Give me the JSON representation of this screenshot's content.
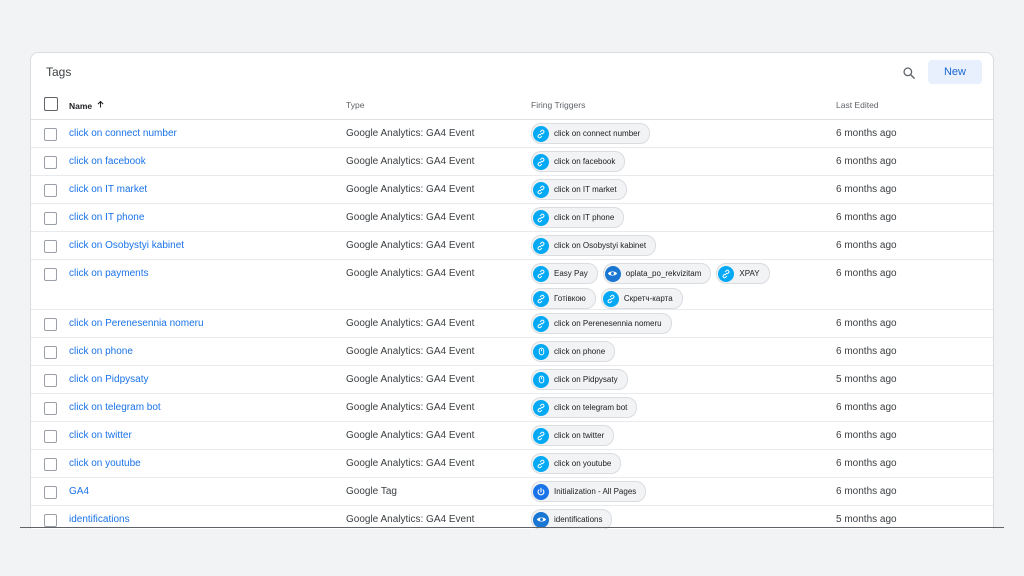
{
  "header": {
    "title": "Tags",
    "new_label": "New"
  },
  "columns": {
    "name": "Name",
    "type": "Type",
    "triggers": "Firing Triggers",
    "edited": "Last Edited"
  },
  "colors": {
    "link": "#1a73e8",
    "link_trigger": "#03a9f4",
    "eye_trigger": "#1976d2",
    "click_trigger": "#03a9f4",
    "pageview_trigger": "#1a73e8",
    "new_button_bg": "#e8f0fe"
  },
  "rows": [
    {
      "name": "click on connect number",
      "type": "Google Analytics: GA4 Event",
      "edited": "6 months ago",
      "triggers": [
        {
          "label": "click on connect number",
          "icon": "link-icon"
        }
      ]
    },
    {
      "name": "click on facebook",
      "type": "Google Analytics: GA4 Event",
      "edited": "6 months ago",
      "triggers": [
        {
          "label": "click on facebook",
          "icon": "link-icon"
        }
      ]
    },
    {
      "name": "click on IT market",
      "type": "Google Analytics: GA4 Event",
      "edited": "6 months ago",
      "triggers": [
        {
          "label": "click on IT market",
          "icon": "link-icon"
        }
      ]
    },
    {
      "name": "click on IT phone",
      "type": "Google Analytics: GA4 Event",
      "edited": "6 months ago",
      "triggers": [
        {
          "label": "click on IT phone",
          "icon": "link-icon"
        }
      ]
    },
    {
      "name": "click on Osobystyi kabinet",
      "type": "Google Analytics: GA4 Event",
      "edited": "6 months ago",
      "triggers": [
        {
          "label": "click on Osobystyi kabinet",
          "icon": "link-icon"
        }
      ]
    },
    {
      "name": "click on payments",
      "type": "Google Analytics: GA4 Event",
      "edited": "6 months ago",
      "triggers": [
        {
          "label": "Easy Pay",
          "icon": "link-icon"
        },
        {
          "label": "oplata_po_rekvizitam",
          "icon": "eye-icon"
        },
        {
          "label": "XPAY",
          "icon": "link-icon"
        },
        {
          "label": "Готівкою",
          "icon": "link-icon"
        },
        {
          "label": "Скретч-карта",
          "icon": "link-icon"
        }
      ]
    },
    {
      "name": "click on Perenesennia nomeru",
      "type": "Google Analytics: GA4 Event",
      "edited": "6 months ago",
      "triggers": [
        {
          "label": "click on Perenesennia nomeru",
          "icon": "link-icon"
        }
      ]
    },
    {
      "name": "click on phone",
      "type": "Google Analytics: GA4 Event",
      "edited": "6 months ago",
      "triggers": [
        {
          "label": "click on phone",
          "icon": "mouse-icon"
        }
      ]
    },
    {
      "name": "click on Pidpysaty",
      "type": "Google Analytics: GA4 Event",
      "edited": "5 months ago",
      "triggers": [
        {
          "label": "click on Pidpysaty",
          "icon": "mouse-icon"
        }
      ]
    },
    {
      "name": "click on telegram bot",
      "type": "Google Analytics: GA4 Event",
      "edited": "6 months ago",
      "triggers": [
        {
          "label": "click on telegram bot",
          "icon": "link-icon"
        }
      ]
    },
    {
      "name": "click on twitter",
      "type": "Google Analytics: GA4 Event",
      "edited": "6 months ago",
      "triggers": [
        {
          "label": "click on twitter",
          "icon": "link-icon"
        }
      ]
    },
    {
      "name": "click on youtube",
      "type": "Google Analytics: GA4 Event",
      "edited": "6 months ago",
      "triggers": [
        {
          "label": "click on youtube",
          "icon": "link-icon"
        }
      ]
    },
    {
      "name": "GA4",
      "type": "Google Tag",
      "edited": "6 months ago",
      "triggers": [
        {
          "label": "Initialization - All Pages",
          "icon": "power-icon"
        }
      ]
    },
    {
      "name": "identifications",
      "type": "Google Analytics: GA4 Event",
      "edited": "5 months ago",
      "triggers": [
        {
          "label": "identifications",
          "icon": "eye-icon"
        }
      ]
    }
  ]
}
